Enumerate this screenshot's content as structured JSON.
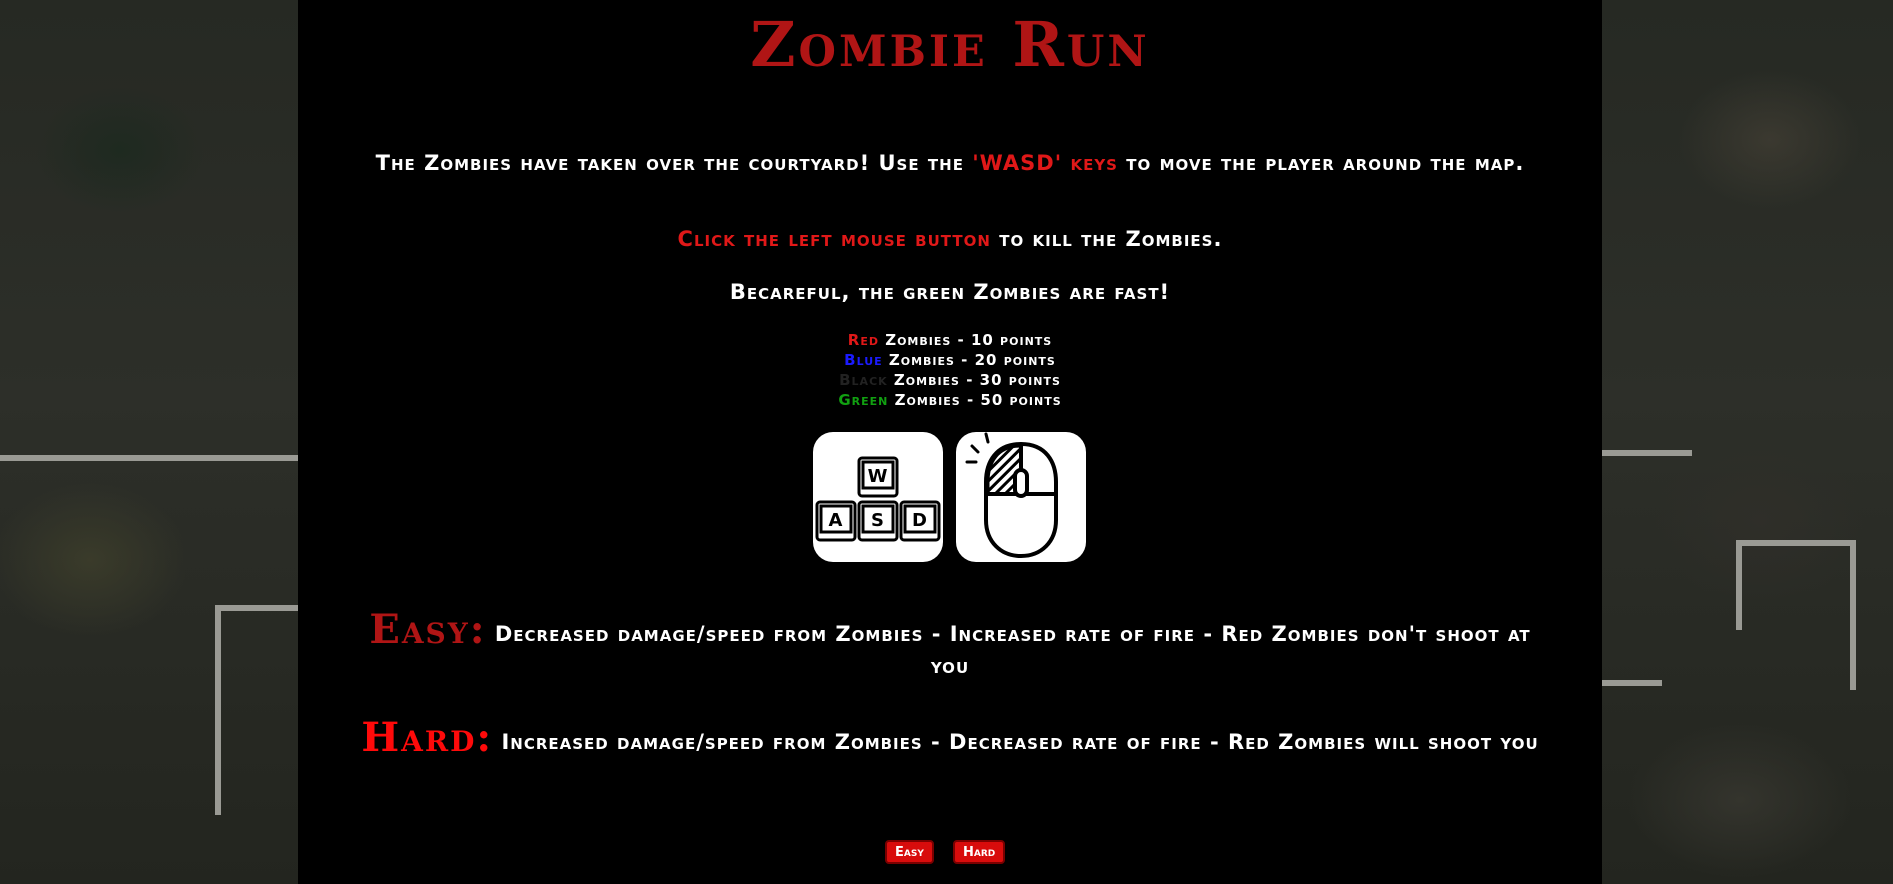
{
  "title": "Zombie Run",
  "intro": {
    "before": "The Zombies have taken over the courtyard! Use the ",
    "highlight": "'WASD' keys",
    "after": " to move the player around the map."
  },
  "click": {
    "highlight": "Click the left mouse button",
    "after": " to kill the Zombies."
  },
  "warning": "Becareful, the green Zombies are fast!",
  "points": [
    {
      "color_word": "Red",
      "rest": " Zombies - 10 points",
      "color": "#e01818"
    },
    {
      "color_word": "Blue",
      "rest": " Zombies - 20 points",
      "color": "#1b1bff"
    },
    {
      "color_word": "Black",
      "rest": " Zombies - 30 points",
      "color": "#222222"
    },
    {
      "color_word": "Green",
      "rest": " Zombies - 50 points",
      "color": "#11a011"
    }
  ],
  "icons": {
    "keyboard": "wasd-keys-icon",
    "keys": [
      "W",
      "A",
      "S",
      "D"
    ],
    "mouse": "mouse-left-click-icon"
  },
  "easy": {
    "label": "Easy:",
    "description": " Decreased damage/speed from Zombies - Increased rate of fire - Red Zombies don't shoot at you"
  },
  "hard": {
    "label": "Hard:",
    "description": " Increased damage/speed from Zombies - Decreased rate of fire - Red Zombies will shoot you"
  },
  "buttons": {
    "easy": "Easy",
    "hard": "Hard"
  },
  "colors": {
    "title": "#b01515",
    "accent": "#e01818",
    "panel": "#000000",
    "button": "#d80c0c"
  }
}
